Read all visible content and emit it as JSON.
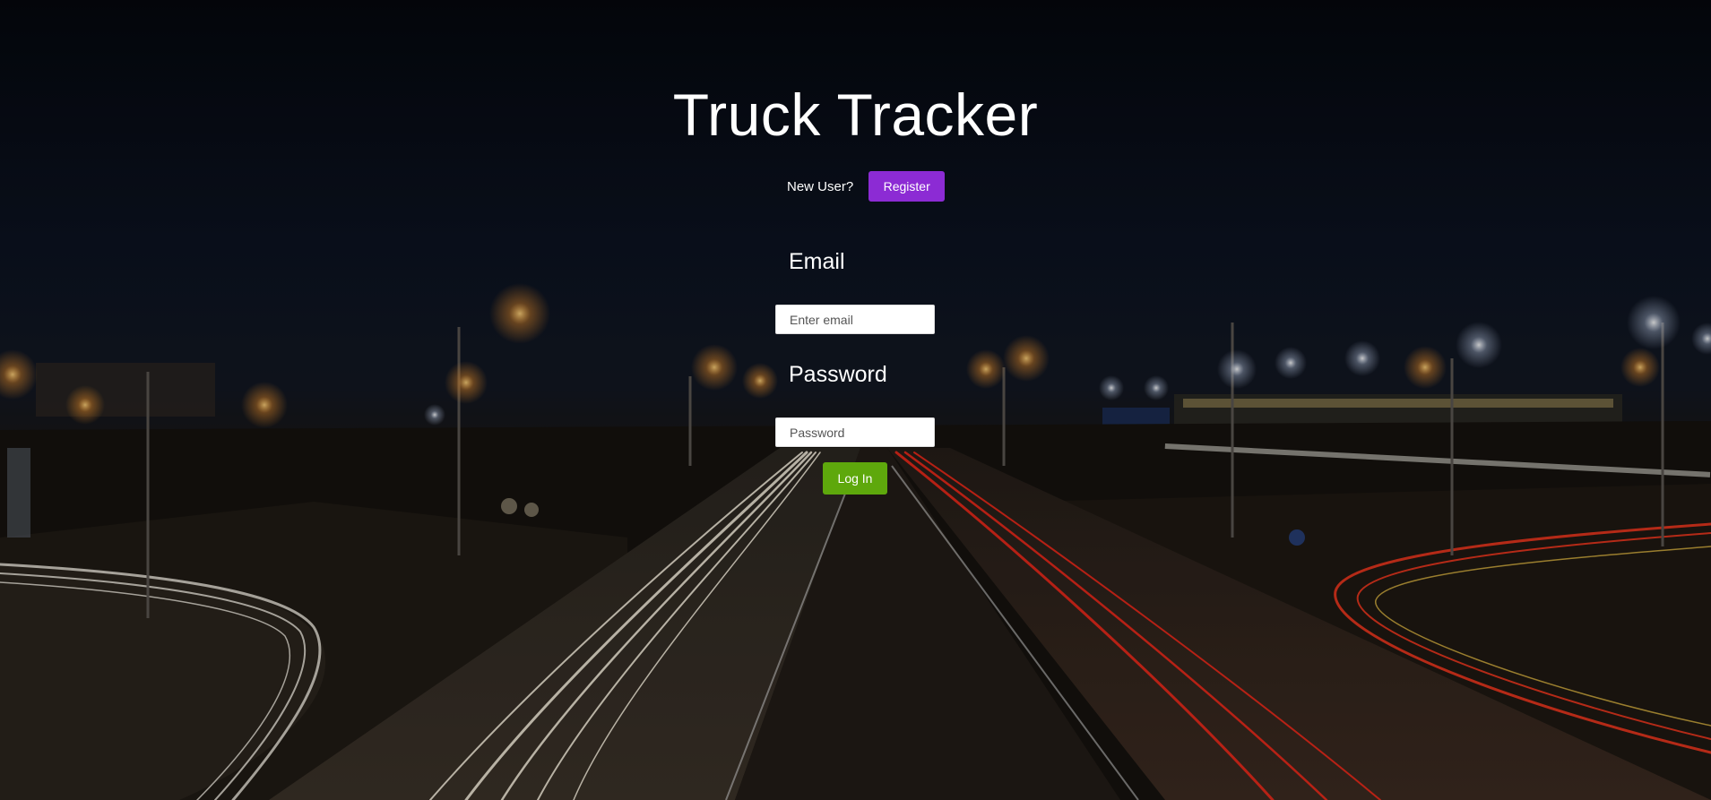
{
  "app": {
    "title": "Truck Tracker"
  },
  "register": {
    "prompt": "New User?",
    "button_label": "Register"
  },
  "form": {
    "email_label": "Email",
    "email_placeholder": "Enter email",
    "password_label": "Password",
    "password_placeholder": "Password",
    "login_label": "Log In"
  },
  "colors": {
    "register_button": "#8c2bd4",
    "login_button": "#5ea80c",
    "text": "#ffffff"
  },
  "background": {
    "description_icon": "night-highway-background"
  }
}
